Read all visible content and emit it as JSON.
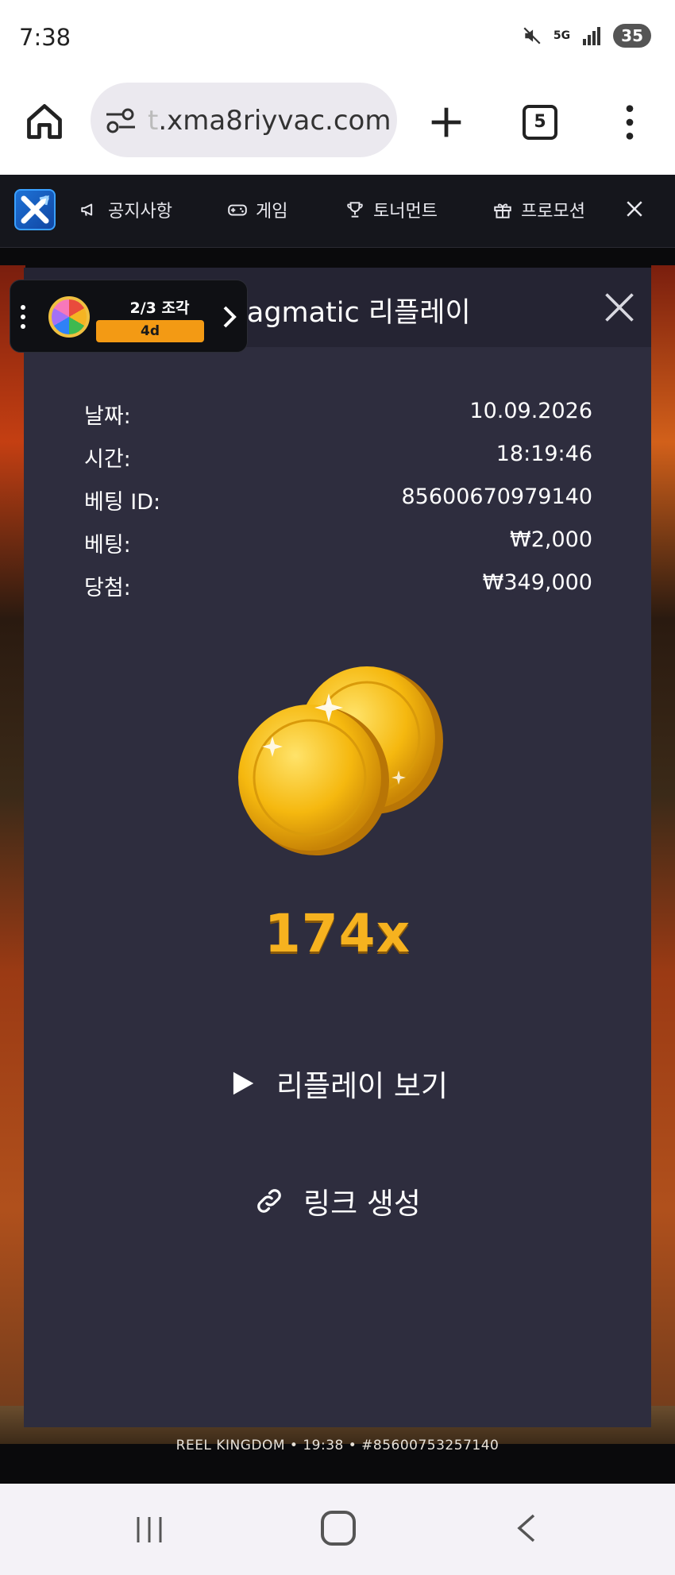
{
  "status_bar": {
    "time": "7:38",
    "network": "5G",
    "battery": "35"
  },
  "browser": {
    "url_prefix": "t",
    "url": ".xma8riyvac.com",
    "tab_count": "5"
  },
  "site_nav": {
    "items": [
      {
        "label": "공지사항",
        "icon": "megaphone-icon"
      },
      {
        "label": "게임",
        "icon": "gamepad-icon"
      },
      {
        "label": "토너먼트",
        "icon": "trophy-icon"
      },
      {
        "label": "프로모션",
        "icon": "gift-icon"
      }
    ]
  },
  "promo": {
    "title": "2/3 조각",
    "badge": "4d"
  },
  "modal": {
    "title": "Pragmatic 리플레이",
    "rows": [
      {
        "key": "날짜:",
        "value": "10.09.2026"
      },
      {
        "key": "시간:",
        "value": "18:19:46"
      },
      {
        "key": "베팅 ID:",
        "value": "85600670979140"
      },
      {
        "key": "베팅:",
        "value": "₩2,000"
      },
      {
        "key": "당첨:",
        "value": "₩349,000"
      }
    ],
    "multiplier": "174x",
    "watch_replay": "리플레이 보기",
    "create_link": "링크 생성"
  },
  "game_footer": {
    "text": "REEL KINGDOM • 19:38 • #85600753257140"
  },
  "colors": {
    "modal_bg": "#2e2d3e",
    "modal_header_bg": "#252433",
    "accent_gold": "#f6b21f",
    "site_nav_bg": "#15161c"
  }
}
